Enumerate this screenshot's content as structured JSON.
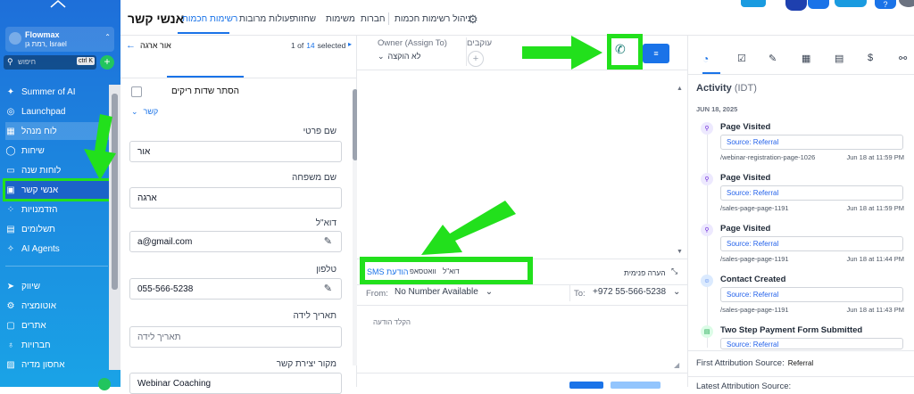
{
  "sidebar": {
    "company": "Flowmax",
    "location": "רמת גן, Israel",
    "search_placeholder": "חיפוש",
    "shortcut": "ctrl K",
    "items": [
      {
        "label": "Summer of AI",
        "icon": "sparkle-icon"
      },
      {
        "label": "Launchpad",
        "icon": "rocket-icon"
      },
      {
        "label": "לוח מנהל",
        "icon": "dashboard-icon"
      },
      {
        "label": "שיחות",
        "icon": "chat-icon"
      },
      {
        "label": "לוחות שנה",
        "icon": "calendar-icon"
      },
      {
        "label": "אנשי קשר",
        "icon": "contacts-icon"
      },
      {
        "label": "הזדמנויות",
        "icon": "opportunities-icon"
      },
      {
        "label": "תשלומים",
        "icon": "payments-icon"
      },
      {
        "label": "AI Agents",
        "icon": "ai-icon"
      },
      {
        "label": "שיווק",
        "icon": "send-icon"
      },
      {
        "label": "אוטומציה",
        "icon": "automation-icon"
      },
      {
        "label": "אתרים",
        "icon": "sites-icon"
      },
      {
        "label": "חברויות",
        "icon": "membership-icon"
      },
      {
        "label": "אחסון מדיה",
        "icon": "media-icon"
      }
    ]
  },
  "topbar": {
    "page_title": "אנשי קשר",
    "tabs": [
      "רשימות חכמות",
      "פעולות מרובות",
      "שחזור",
      "משימות",
      "חברות",
      "ניהול רשימות חכמות"
    ],
    "active_tab": "רשימות חכמות"
  },
  "contact_panel": {
    "contact_name": "אור ארגה",
    "pager_text": "1 of",
    "pager_total": "14",
    "pager_selected": "selected",
    "hide_empty": "הסתר שדות ריקים",
    "section": "קשר",
    "fields": [
      {
        "label": "שם פרטי",
        "value": "אור"
      },
      {
        "label": "שם משפחה",
        "value": "ארגה"
      },
      {
        "label": "דוא\"ל",
        "value": "a@gmail.com"
      },
      {
        "label": "טלפון",
        "value": "055-566-5238"
      },
      {
        "label": "תאריך לידה",
        "value": "",
        "placeholder": "תאריך לידה"
      },
      {
        "label": "מקור יצירת קשר",
        "value": "Webinar Coaching"
      }
    ]
  },
  "middle": {
    "owner_label": "Owner (Assign To)",
    "owner_value": "לא הוקצה",
    "followers_label": "עוקבים",
    "compose_tabs": [
      "SMS הודעת",
      "וואטסאפ",
      "דוא\"ל"
    ],
    "internal_note": "הערה פנימית",
    "from_label": "From:",
    "from_value": "No Number Available",
    "to_label": "To:",
    "to_value": "+972 55-566-5238",
    "message_placeholder": "הקלד הודעה"
  },
  "activity": {
    "title": "Activity",
    "tz": "(IDT)",
    "date": "JUN 18, 2025",
    "items": [
      {
        "title": "Page Visited",
        "source": "Source: Referral",
        "page": "/webinar-registration-page-1026",
        "time": "Jun 18 at 11:59 PM"
      },
      {
        "title": "Page Visited",
        "source": "Source: Referral",
        "page": "/sales-page-page-1191",
        "time": "Jun 18 at 11:59 PM"
      },
      {
        "title": "Page Visited",
        "source": "Source: Referral",
        "page": "/sales-page-page-1191",
        "time": "Jun 18 at 11:44 PM"
      },
      {
        "title": "Contact Created",
        "source": "Source: Referral",
        "page": "/sales-page-page-1191",
        "time": "Jun 18 at 11:43 PM"
      },
      {
        "title": "Two Step Payment Form Submitted",
        "source": "Source: Referral"
      }
    ],
    "first_attr_label": "First Attribution Source:",
    "first_attr_value": "Referral",
    "latest_attr_label": "Latest Attribution Source:"
  },
  "colors": {
    "accent": "#1a73e8",
    "highlight_green": "#22e01c"
  }
}
